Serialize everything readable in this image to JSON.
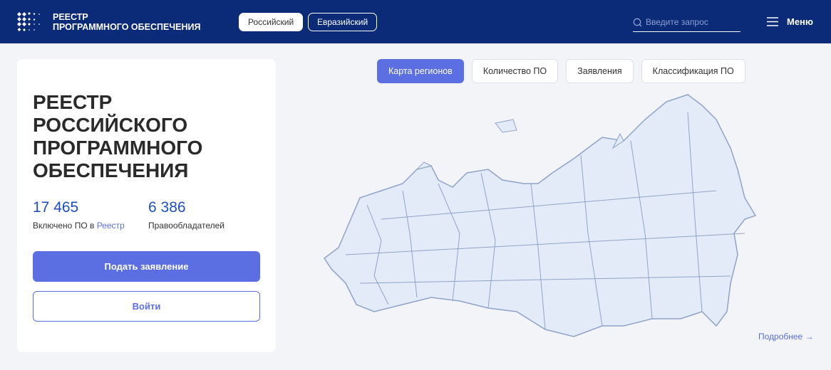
{
  "header": {
    "brand_line1": "РЕЕСТР",
    "brand_line2": "ПРОГРАММНОГО ОБЕСПЕЧЕНИЯ",
    "switch": [
      "Российский",
      "Евразийский"
    ],
    "search_placeholder": "Введите запрос",
    "menu_label": "Меню"
  },
  "card": {
    "title": "РЕЕСТР РОССИЙСКОГО ПРОГРАММНОГО ОБЕСПЕЧЕНИЯ",
    "stat1_value": "17 465",
    "stat1_label": "Включено ПО в",
    "stat1_link": "Реестр",
    "stat2_value": "6 386",
    "stat2_label": "Правообладателей",
    "apply_button": "Подать заявление",
    "login_button": "Войти"
  },
  "tabs": [
    "Карта регионов",
    "Количество ПО",
    "Заявления",
    "Классификация ПО"
  ],
  "more_link": "Подробнее →",
  "colors": {
    "header": "#0b2a78",
    "accent": "#5b6fe3",
    "map_fill": "#e3ebf8",
    "map_stroke": "#8ea3c8"
  }
}
